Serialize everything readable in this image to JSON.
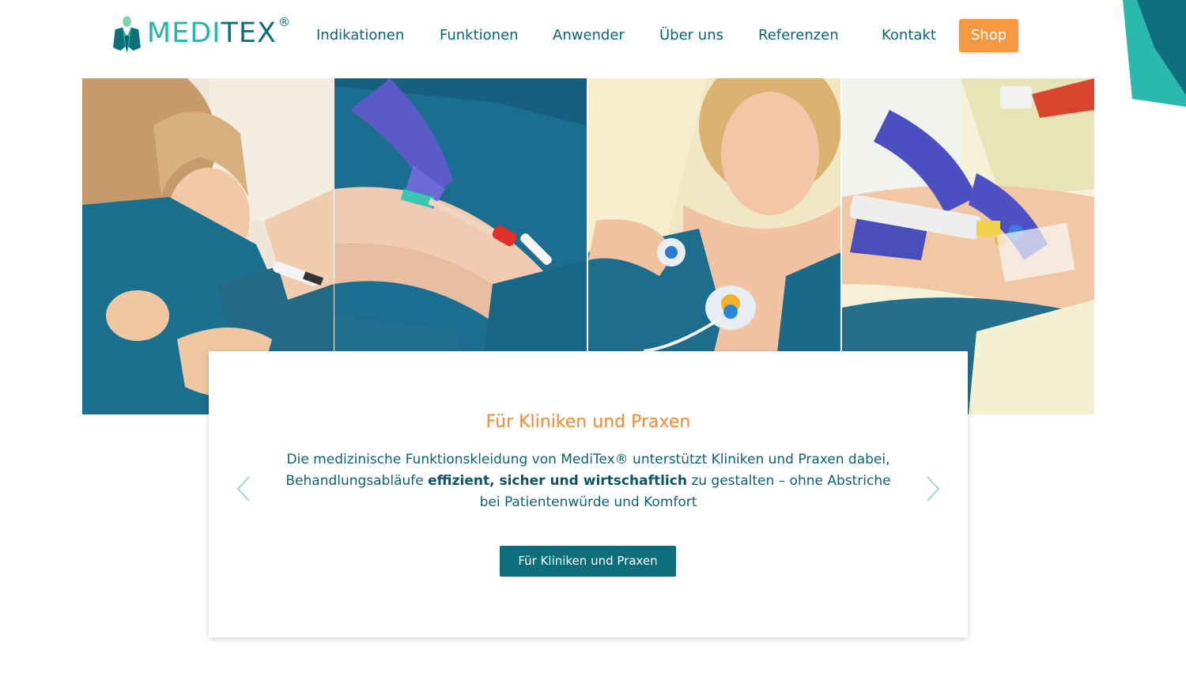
{
  "brand": {
    "name_part1": "MEDI",
    "name_part2": "TEX",
    "registered": "®"
  },
  "nav": {
    "items": [
      {
        "label": "Indikationen"
      },
      {
        "label": "Funktionen"
      },
      {
        "label": "Anwender"
      },
      {
        "label": "Über uns"
      },
      {
        "label": "Referenzen"
      },
      {
        "label": "Kontakt"
      }
    ],
    "shop_label": "Shop"
  },
  "hero": {
    "photos": [
      {
        "icon": "child-patient-photo"
      },
      {
        "icon": "arm-catheter-photo"
      },
      {
        "icon": "woman-port-photo"
      },
      {
        "icon": "syringe-infusion-photo"
      }
    ]
  },
  "slide": {
    "title": "Für Kliniken und Praxen",
    "text_before": "Die medizinische Funktionskleidung von MediTex® unterstützt Kliniken und Praxen dabei, Behandlungsabläufe ",
    "text_bold": "effizient, sicher und wirtschaftlich",
    "text_after": " zu gestalten – ohne Abstriche bei Patientenwürde und Komfort",
    "button_label": "Für Kliniken und Praxen"
  },
  "colors": {
    "teal_dark": "#0e6d7b",
    "teal_light": "#29b4a8",
    "orange": "#f39a40",
    "text": "#0d6373"
  }
}
